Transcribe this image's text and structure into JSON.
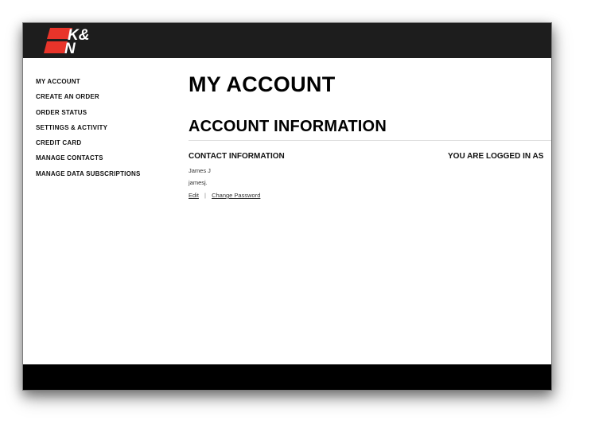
{
  "brand": {
    "logo_text_top": "K&",
    "logo_text_bottom": "N",
    "colors": {
      "header_bg": "#1d1d1d",
      "logo_red": "#e8342a",
      "logo_text": "#ffffff",
      "footer_bg": "#000000"
    }
  },
  "sidebar": {
    "items": [
      {
        "label": "MY ACCOUNT"
      },
      {
        "label": "CREATE AN ORDER"
      },
      {
        "label": "ORDER STATUS"
      },
      {
        "label": "SETTINGS & ACTIVITY"
      },
      {
        "label": "CREDIT CARD"
      },
      {
        "label": "MANAGE CONTACTS"
      },
      {
        "label": "MANAGE DATA SUBSCRIPTIONS"
      }
    ]
  },
  "main": {
    "page_title": "MY ACCOUNT",
    "section_title": "ACCOUNT INFORMATION",
    "contact": {
      "heading": "CONTACT INFORMATION",
      "name": "James J",
      "username": "jamesj.",
      "edit_label": "Edit",
      "separator": "|",
      "change_password_label": "Change Password"
    },
    "logged_in": {
      "heading": "YOU ARE LOGGED IN AS"
    }
  }
}
